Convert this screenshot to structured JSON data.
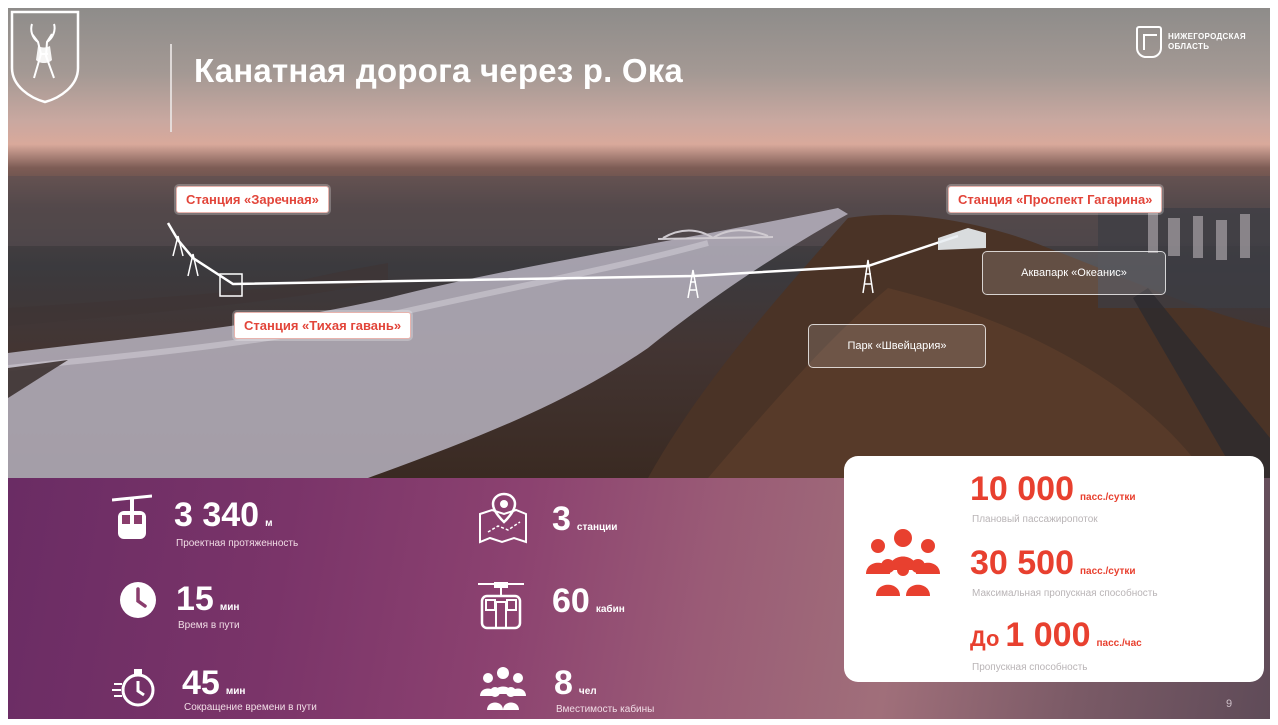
{
  "title": "Канатная дорога через р. Ока",
  "brand": {
    "line1": "НИЖЕГОРОДСКАЯ",
    "line2": "ОБЛАСТЬ"
  },
  "map_labels": {
    "station_zarechnaya": "Станция «Заречная»",
    "station_gagarin": "Станция «Проспект Гагарина»",
    "station_tikhaya": "Станция «Тихая гавань»",
    "aquapark": "Аквапарк «Океанис»",
    "park": "Парк «Швейцария»"
  },
  "stats": [
    {
      "icon": "cable-car-icon",
      "value": "3 340",
      "unit": "м",
      "caption": "Проектная протяженность"
    },
    {
      "icon": "clock-icon",
      "value": "15",
      "unit": "мин",
      "caption": "Время в пути"
    },
    {
      "icon": "stopwatch-icon",
      "value": "45",
      "unit": "мин",
      "caption": "Сокращение времени в пути"
    },
    {
      "icon": "map-pin-icon",
      "value": "3",
      "unit": "станции",
      "caption": ""
    },
    {
      "icon": "gondola-icon",
      "value": "60",
      "unit": "кабин",
      "caption": ""
    },
    {
      "icon": "people-icon",
      "value": "8",
      "unit": "чел",
      "caption": "Вместимость кабины"
    }
  ],
  "panel": [
    {
      "value": "10 000",
      "unit": "пасс./сутки",
      "caption": "Плановый пассажиропоток"
    },
    {
      "value": "30 500",
      "unit": "пасс./сутки",
      "caption": "Максимальная пропускная способность"
    },
    {
      "prefix": "До",
      "value": "1 000",
      "unit": "пасс./час",
      "caption": "Пропускная способность"
    }
  ],
  "panel_icon": "crowd-icon",
  "page_number": "9",
  "colors": {
    "accent_red": "#e8402f",
    "band_purple": "#7a3469",
    "panel_bg": "#ffffff"
  }
}
